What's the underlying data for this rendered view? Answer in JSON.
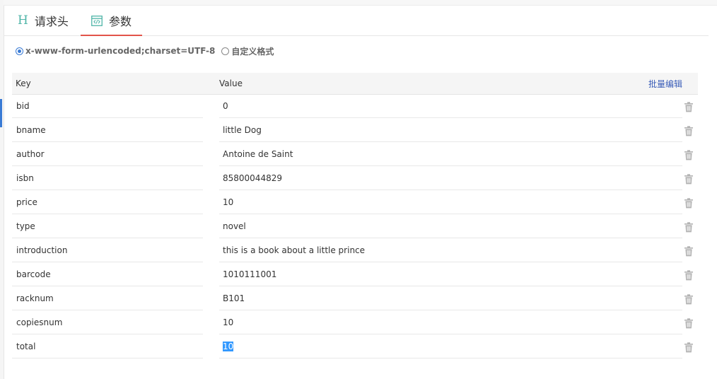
{
  "tabs": [
    {
      "label": "请求头",
      "icon": "heading-h-icon"
    },
    {
      "label": "参数",
      "icon": "code-window-icon",
      "active": true
    }
  ],
  "body_format": {
    "options": [
      {
        "label": "x-www-form-urlencoded;charset=UTF-8",
        "checked": true
      },
      {
        "label": "自定义格式",
        "checked": false
      }
    ]
  },
  "table": {
    "key_header": "Key",
    "value_header": "Value",
    "bulk_edit_label": "批量编辑",
    "rows": [
      {
        "key": "bid",
        "value": "0"
      },
      {
        "key": "bname",
        "value": "little Dog"
      },
      {
        "key": "author",
        "value": "Antoine de Saint"
      },
      {
        "key": "isbn",
        "value": "85800044829"
      },
      {
        "key": "price",
        "value": "10"
      },
      {
        "key": "type",
        "value": "novel"
      },
      {
        "key": "introduction",
        "value": "this is a book about a little prince"
      },
      {
        "key": "barcode",
        "value": "1010111001"
      },
      {
        "key": "racknum",
        "value": "B101"
      },
      {
        "key": "copiesnum",
        "value": "10"
      },
      {
        "key": "total",
        "value": "10",
        "selected": true
      }
    ]
  },
  "colors": {
    "accent": "#3a7bd5",
    "tab_underline": "#e2544a",
    "icon_teal": "#4fb5a8",
    "link": "#3a5db8"
  }
}
